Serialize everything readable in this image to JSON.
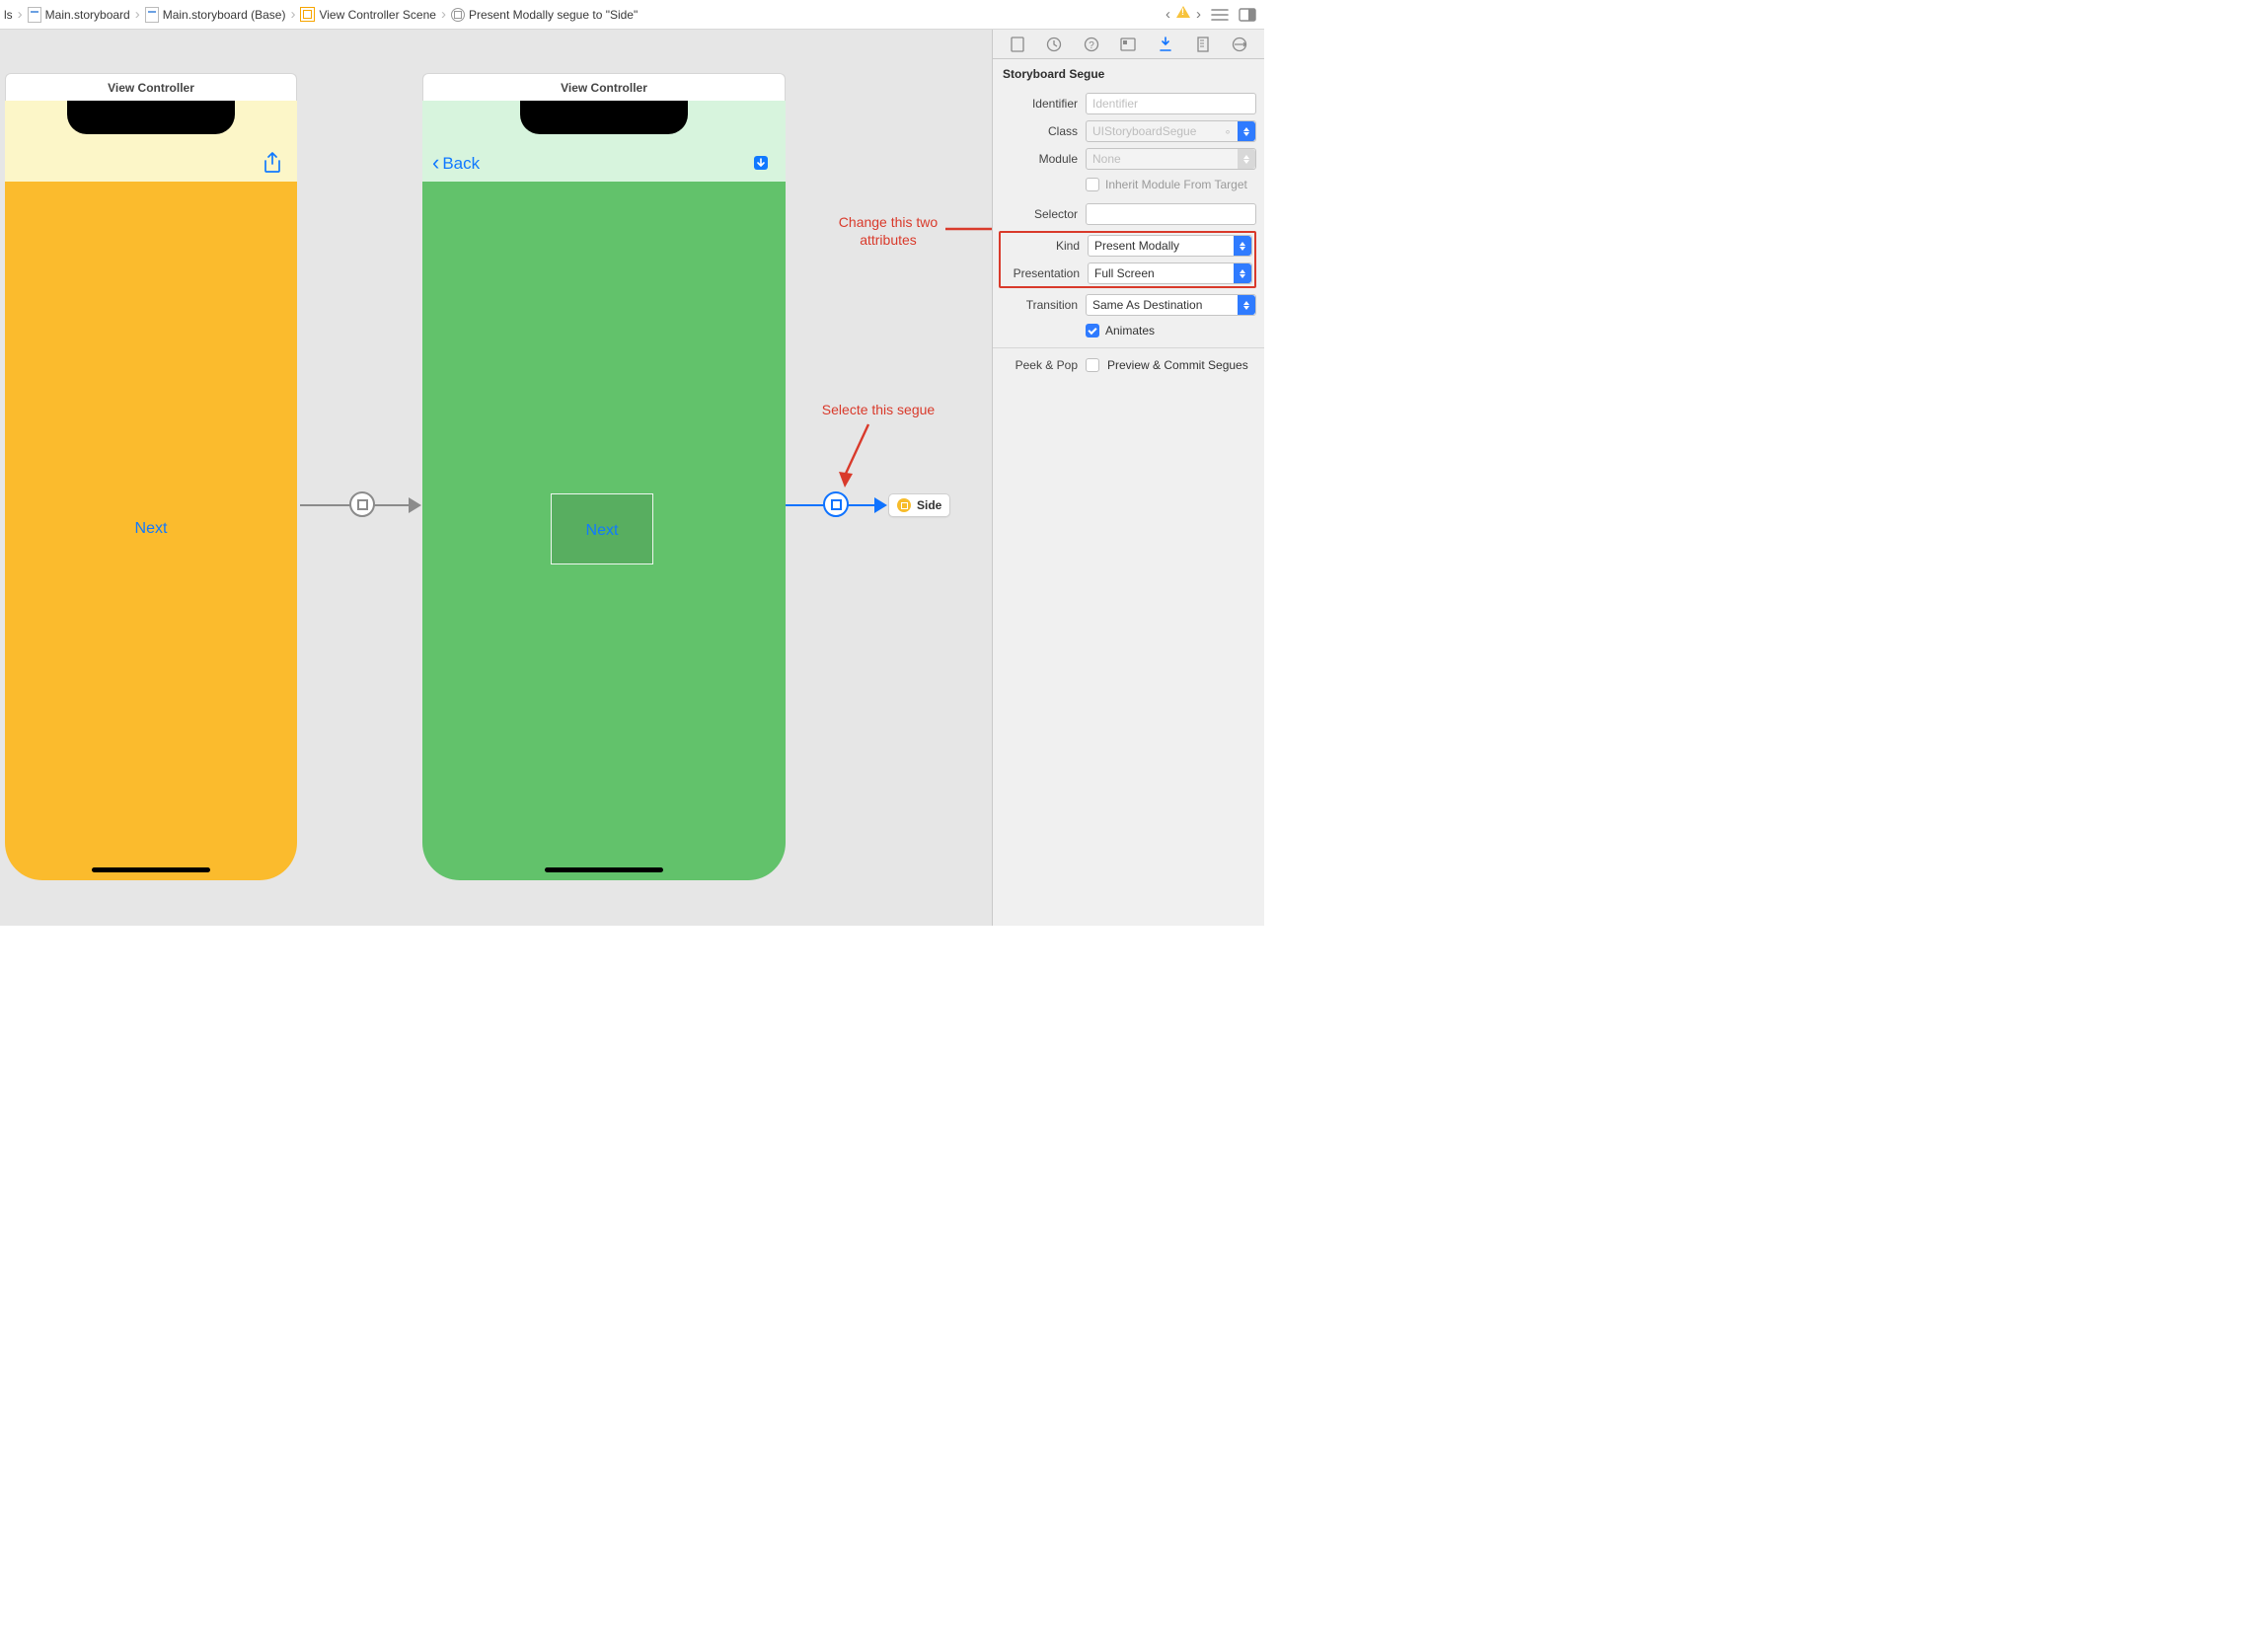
{
  "breadcrumbs": {
    "item0": "ls",
    "item1": "Main.storyboard",
    "item2": "Main.storyboard (Base)",
    "item3": "View Controller Scene",
    "item4": "Present Modally segue to \"Side\""
  },
  "canvas": {
    "vc1_title": "View Controller",
    "vc2_title": "View Controller",
    "next_label": "Next",
    "container_next_label": "Next",
    "back_label": "Back",
    "side_chip_label": "Side"
  },
  "annotations": {
    "change_line1": "Change this two",
    "change_line2": "attributes",
    "select_segue": "Selecte this segue"
  },
  "inspector": {
    "section_title": "Storyboard Segue",
    "identifier_label": "Identifier",
    "identifier_placeholder": "Identifier",
    "class_label": "Class",
    "class_value": "UIStoryboardSegue",
    "module_label": "Module",
    "module_value": "None",
    "inherit_label": "Inherit Module From Target",
    "selector_label": "Selector",
    "selector_value": "",
    "kind_label": "Kind",
    "kind_value": "Present Modally",
    "presentation_label": "Presentation",
    "presentation_value": "Full Screen",
    "transition_label": "Transition",
    "transition_value": "Same As Destination",
    "animates_label": "Animates",
    "peek_pop_label": "Peek & Pop",
    "peek_pop_value": "Preview & Commit Segues"
  }
}
